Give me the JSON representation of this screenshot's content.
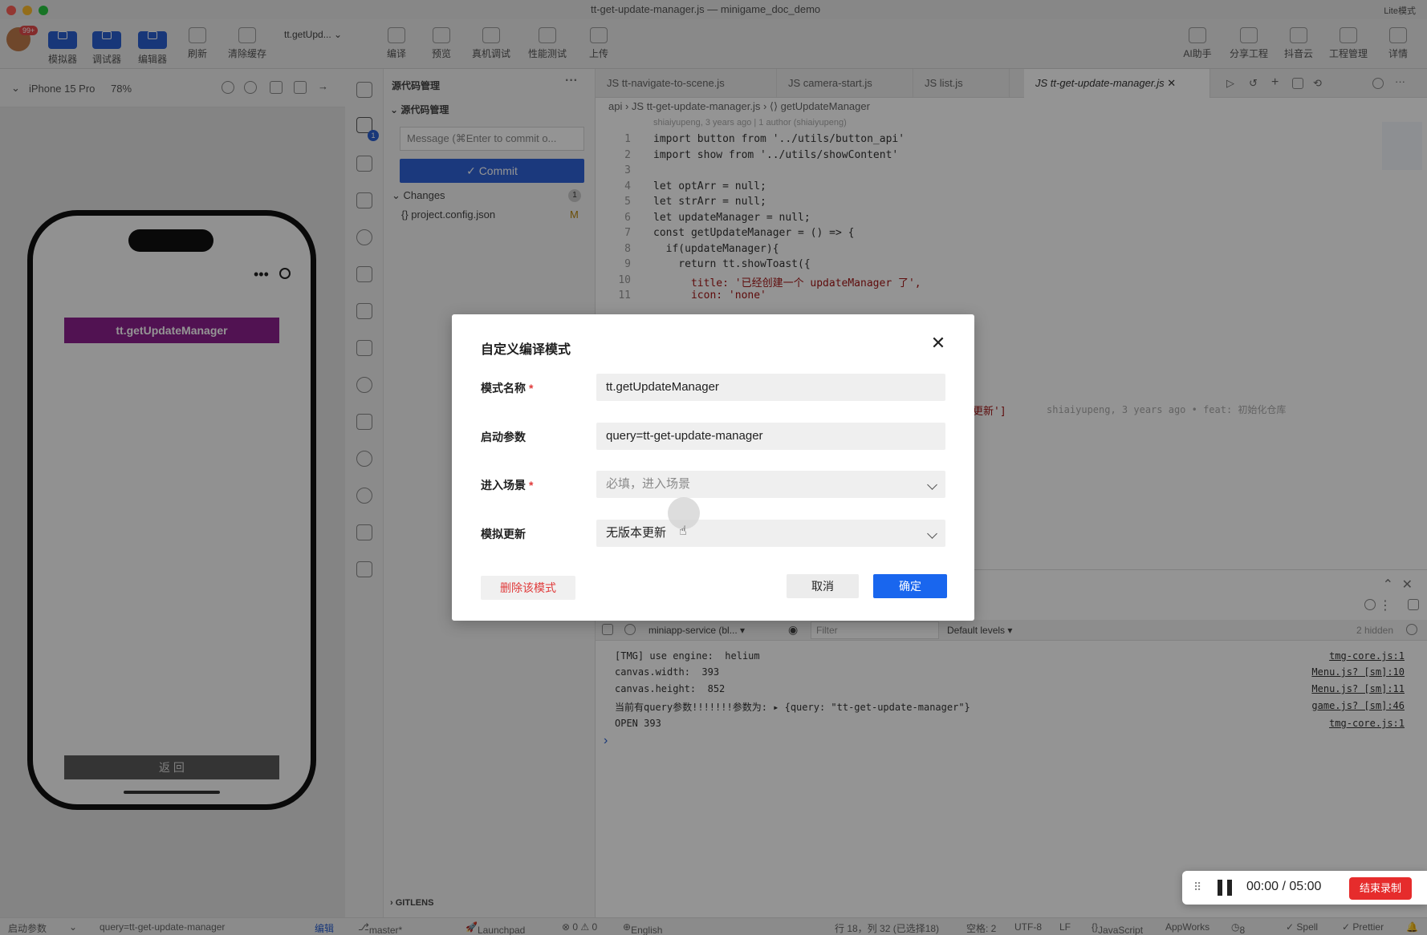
{
  "window": {
    "title": "tt-get-update-manager.js — minigame_doc_demo",
    "mode": "Lite模式"
  },
  "toolbar": {
    "badge": "99+",
    "left": [
      {
        "label": "模拟器"
      },
      {
        "label": "调试器"
      },
      {
        "label": "编辑器"
      },
      {
        "label": "刷新"
      },
      {
        "label": "清除缓存"
      }
    ],
    "mode_select": "tt.getUpd...",
    "center": [
      {
        "label": "编译"
      },
      {
        "label": "预览"
      },
      {
        "label": "真机调试"
      },
      {
        "label": "性能测试"
      },
      {
        "label": "上传"
      }
    ],
    "right": [
      {
        "label": "AI助手"
      },
      {
        "label": "分享工程"
      },
      {
        "label": "抖音云"
      },
      {
        "label": "工程管理"
      },
      {
        "label": "详情"
      }
    ]
  },
  "simulator": {
    "device": "iPhone 15 Pro",
    "zoom": "78%",
    "app_button": "tt.getUpdateManager",
    "back_button": "返 回"
  },
  "scm": {
    "title": "源代码管理",
    "section": "源代码管理",
    "message_placeholder": "Message (⌘Enter to commit o...",
    "commit": "✓ Commit",
    "changes": "Changes",
    "changes_count": "1",
    "file": "project.config.json",
    "file_status": "M",
    "gitlens": "GITLENS"
  },
  "editor": {
    "tabs": [
      "tt-navigate-to-scene.js",
      "camera-start.js",
      "list.js",
      "tt-get-update-manager.js"
    ],
    "breadcrumb": [
      "api",
      "tt-get-update-manager.js",
      "getUpdateManager"
    ],
    "blame": "shiaiyupeng, 3 years ago | 1 author (shiaiyupeng)",
    "lines": [
      {
        "n": "1",
        "t": "import button from '../utils/button_api'"
      },
      {
        "n": "2",
        "t": "import show from '../utils/showContent'"
      },
      {
        "n": "3",
        "t": ""
      },
      {
        "n": "4",
        "t": "let optArr = null;"
      },
      {
        "n": "5",
        "t": "let strArr = null;"
      },
      {
        "n": "6",
        "t": "let updateManager = null;"
      },
      {
        "n": "7",
        "t": "const getUpdateManager = () => {"
      },
      {
        "n": "8",
        "t": "  if(updateManager){"
      },
      {
        "n": "9",
        "t": "    return tt.showToast({"
      },
      {
        "n": "10",
        "t": "      title: '已经创建一个 updateManager 了',"
      },
      {
        "n": "11",
        "t": "      icon: 'none'"
      }
    ],
    "inline_blame": "shiaiyupeng, 3 years ago • feat: 初始化仓库",
    "inline_snippet": "更新']"
  },
  "console": {
    "context": "miniapp-service (bl...",
    "filter_placeholder": "Filter",
    "levels": "Default levels ▾",
    "hidden": "2 hidden",
    "logs": [
      {
        "text": "[TMG] use engine:  helium",
        "src": "tmg-core.js:1"
      },
      {
        "text": "canvas.width:  393",
        "src": "Menu.js? [sm]:10"
      },
      {
        "text": "canvas.height:  852",
        "src": "Menu.js? [sm]:11"
      },
      {
        "text": "当前有query参数!!!!!!!参数为: ▸ {query: \"tt-get-update-manager\"}",
        "src": "game.js? [sm]:46"
      },
      {
        "text": "OPEN 393",
        "src": "tmg-core.js:1"
      }
    ]
  },
  "statusbar": {
    "launch_label": "启动参数",
    "launch_value": "query=tt-get-update-manager",
    "edit": "编辑",
    "branch": "master*",
    "launchpad": "Launchpad",
    "problems": "⊗ 0 ⚠ 0",
    "language": "English",
    "position": "行 18，列 32 (已选择18)",
    "spaces": "空格: 2",
    "encoding": "UTF-8",
    "eol": "LF",
    "lang_mode": "JavaScript",
    "appworks": "AppWorks",
    "time": "8 min",
    "spell": "✓ Spell",
    "prettier": "✓ Prettier"
  },
  "dialog": {
    "title": "自定义编译模式",
    "fields": [
      {
        "label": "模式名称",
        "required": true,
        "value": "tt.getUpdateManager"
      },
      {
        "label": "启动参数",
        "required": false,
        "value": "query=tt-get-update-manager"
      },
      {
        "label": "进入场景",
        "required": true,
        "placeholder": "必填，进入场景"
      },
      {
        "label": "模拟更新",
        "required": false,
        "value": "无版本更新"
      }
    ],
    "delete": "删除该模式",
    "cancel": "取消",
    "ok": "确定"
  },
  "recording": {
    "elapsed": "00:00",
    "total": "05:00",
    "stop": "结束录制"
  }
}
